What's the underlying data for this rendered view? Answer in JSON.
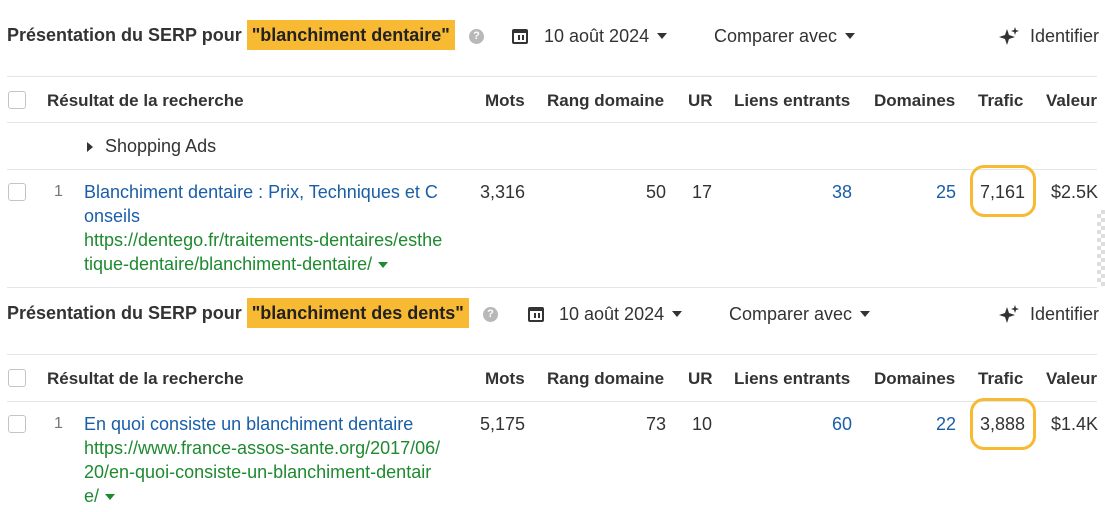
{
  "sections": [
    {
      "title_prefix": "Présentation du SERP pour",
      "keyword": "\"blanchiment dentaire\"",
      "help_icon": "?",
      "date": "10 août 2024",
      "compare": "Comparer avec",
      "identify": "Identifier",
      "headers": {
        "result": "Résultat de la recherche",
        "words": "Mots",
        "domain_rank": "Rang domaine",
        "ur": "UR",
        "backlinks": "Liens entrants",
        "domains": "Domaines",
        "traffic": "Trafic",
        "value": "Valeur"
      },
      "shopping_ads": "Shopping Ads",
      "row": {
        "rank": "1",
        "title_l1": "Blanchiment dentaire : Prix, Techniques et C",
        "title_l2": "onseils",
        "url_l1": "https://dentego.fr/traitements-dentaires/esthe",
        "url_l2": "tique-dentaire/blanchiment-dentaire/",
        "words": "3,316",
        "domain_rank": "50",
        "ur": "17",
        "backlinks": "38",
        "domains": "25",
        "traffic": "7,161",
        "value": "$2.5K"
      }
    },
    {
      "title_prefix": "Présentation du SERP pour",
      "keyword": "\"blanchiment des dents\"",
      "help_icon": "?",
      "date": "10 août 2024",
      "compare": "Comparer avec",
      "identify": "Identifier",
      "headers": {
        "result": "Résultat de la recherche",
        "words": "Mots",
        "domain_rank": "Rang domaine",
        "ur": "UR",
        "backlinks": "Liens entrants",
        "domains": "Domaines",
        "traffic": "Trafic",
        "value": "Valeur"
      },
      "row": {
        "rank": "1",
        "title_l1": "En quoi consiste un blanchiment dentaire",
        "url_l1": "https://www.france-assos-sante.org/2017/06/",
        "url_l2": "20/en-quoi-consiste-un-blanchiment-dentair",
        "url_l3": "e/",
        "words": "5,175",
        "domain_rank": "73",
        "ur": "10",
        "backlinks": "60",
        "domains": "22",
        "traffic": "3,888",
        "value": "$1.4K"
      }
    }
  ],
  "colors": {
    "highlight": "#f8b933",
    "link_blue": "#1a5ea8",
    "url_green": "#1e8a2f"
  }
}
